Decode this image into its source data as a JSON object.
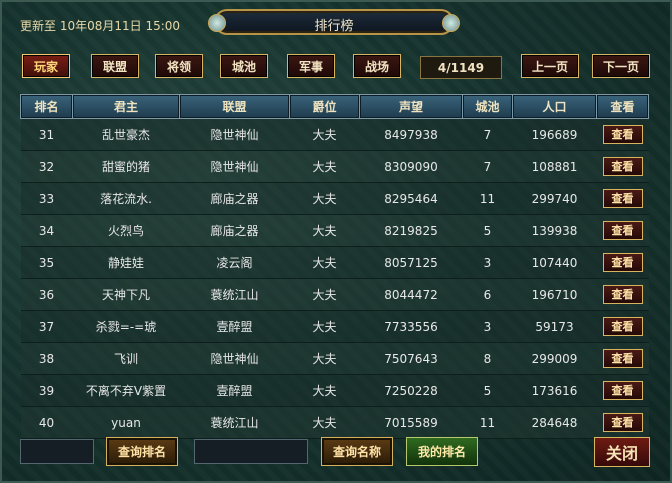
{
  "header": {
    "updated": "更新至 10年08月11日 15:00",
    "title": "排行榜"
  },
  "tabs": [
    {
      "label": "玩家",
      "active": true
    },
    {
      "label": "联盟",
      "active": false
    },
    {
      "label": "将领",
      "active": false
    },
    {
      "label": "城池",
      "active": false
    },
    {
      "label": "军事",
      "active": false
    },
    {
      "label": "战场",
      "active": false
    }
  ],
  "pagination": {
    "indicator": "4/1149",
    "prev": "上一页",
    "next": "下一页"
  },
  "table": {
    "columns": [
      "排名",
      "君主",
      "联盟",
      "爵位",
      "声望",
      "城池",
      "人口",
      "查看"
    ],
    "view_label": "查看",
    "rows": [
      [
        "31",
        "乱世豪杰",
        "隐世神仙",
        "大夫",
        "8497938",
        "7",
        "196689"
      ],
      [
        "32",
        "甜蜜的猪",
        "隐世神仙",
        "大夫",
        "8309090",
        "7",
        "108881"
      ],
      [
        "33",
        "落花流水.",
        "廊庙之器",
        "大夫",
        "8295464",
        "11",
        "299740"
      ],
      [
        "34",
        "火烈鸟",
        "廊庙之器",
        "大夫",
        "8219825",
        "5",
        "139938"
      ],
      [
        "35",
        "静娃娃",
        "凌云阁",
        "大夫",
        "8057125",
        "3",
        "107440"
      ],
      [
        "36",
        "天神下凡",
        "蓑统江山",
        "大夫",
        "8044472",
        "6",
        "196710"
      ],
      [
        "37",
        "杀戮=-=琥",
        "壹醉盟",
        "大夫",
        "7733556",
        "3",
        "59173"
      ],
      [
        "38",
        "飞训",
        "隐世神仙",
        "大夫",
        "7507643",
        "8",
        "299009"
      ],
      [
        "39",
        "不离不弃V紫置",
        "壹醉盟",
        "大夫",
        "7250228",
        "5",
        "173616"
      ],
      [
        "40",
        "yuan",
        "蓑统江山",
        "大夫",
        "7015589",
        "11",
        "284648"
      ]
    ]
  },
  "footer": {
    "query_rank": "查询排名",
    "query_name": "查询名称",
    "my_rank": "我的排名",
    "close": "关闭"
  }
}
